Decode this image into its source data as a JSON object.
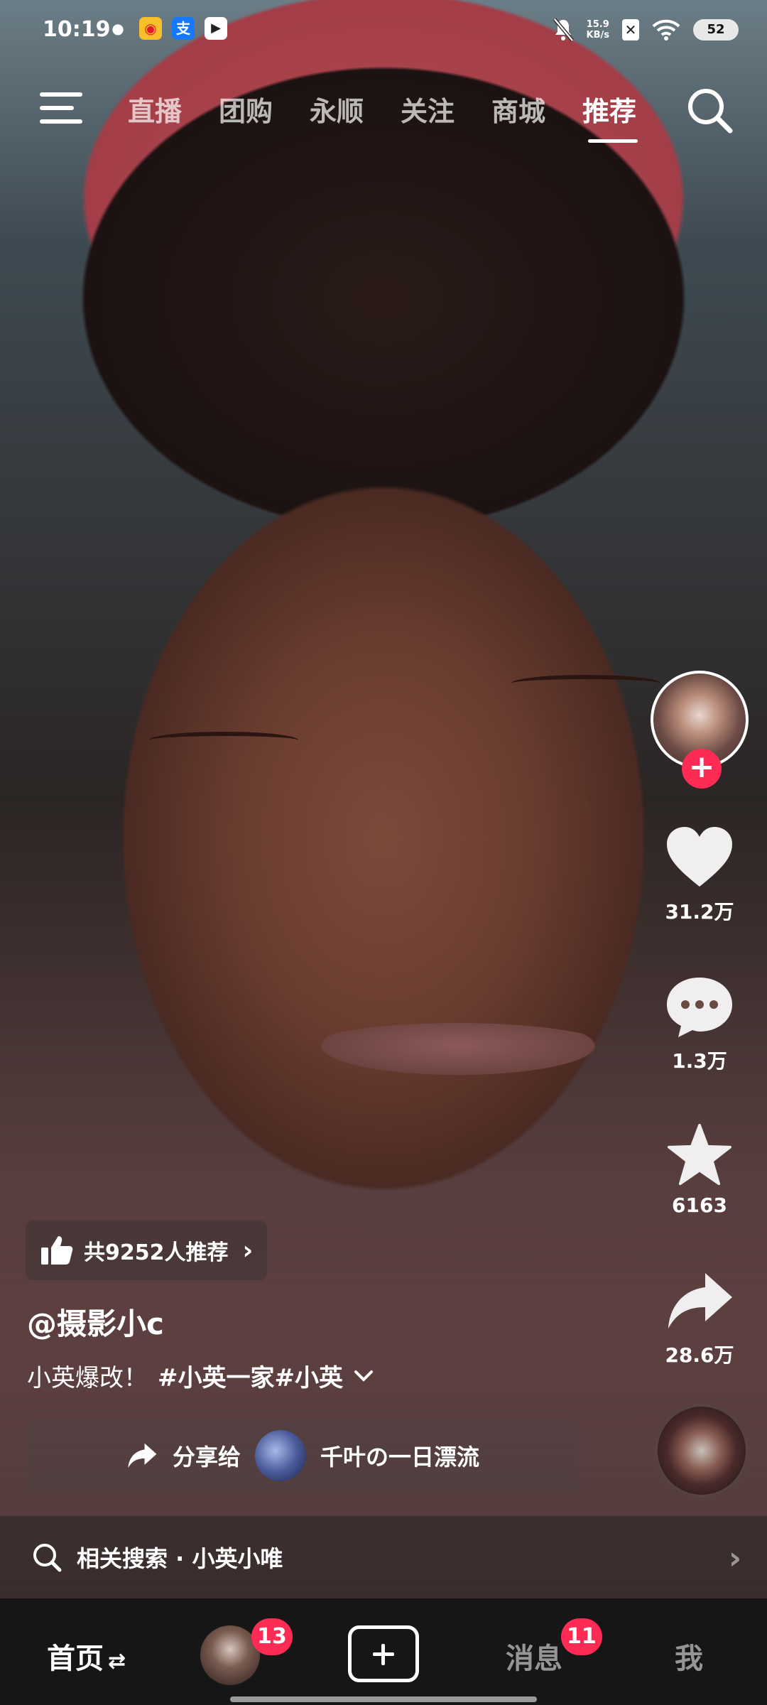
{
  "status_bar": {
    "time": "10:19",
    "apps": [
      "wechat-icon",
      "weibo-icon",
      "alipay-icon",
      "video-icon"
    ],
    "alipay_glyph": "支",
    "net_speed": "15.9",
    "net_unit": "KB/s",
    "battery": "52"
  },
  "top_nav": {
    "tabs": [
      {
        "label": "直播",
        "active": false
      },
      {
        "label": "团购",
        "active": false
      },
      {
        "label": "永顺",
        "active": false
      },
      {
        "label": "关注",
        "active": false
      },
      {
        "label": "商城",
        "active": false
      },
      {
        "label": "推荐",
        "active": true
      }
    ]
  },
  "actions": {
    "likes": "31.2万",
    "comments": "1.3万",
    "favorites": "6163",
    "shares": "28.6万"
  },
  "video_info": {
    "recommend_pill": "共9252人推荐",
    "author": "@摄影小c",
    "caption_text": "小英爆改！",
    "caption_tags": "#小英一家#小英",
    "share_prefix": "分享给",
    "share_target": "千叶の一日漂流",
    "related_search": "相关搜索 · 小英小唯"
  },
  "bottom_bar": {
    "home": "首页",
    "home_suffix": "⇄",
    "friends_badge": "13",
    "messages": "消息",
    "messages_badge": "11",
    "me": "我"
  },
  "colors": {
    "accent": "#fe2c55",
    "bottom_bar_bg": "#161616"
  }
}
